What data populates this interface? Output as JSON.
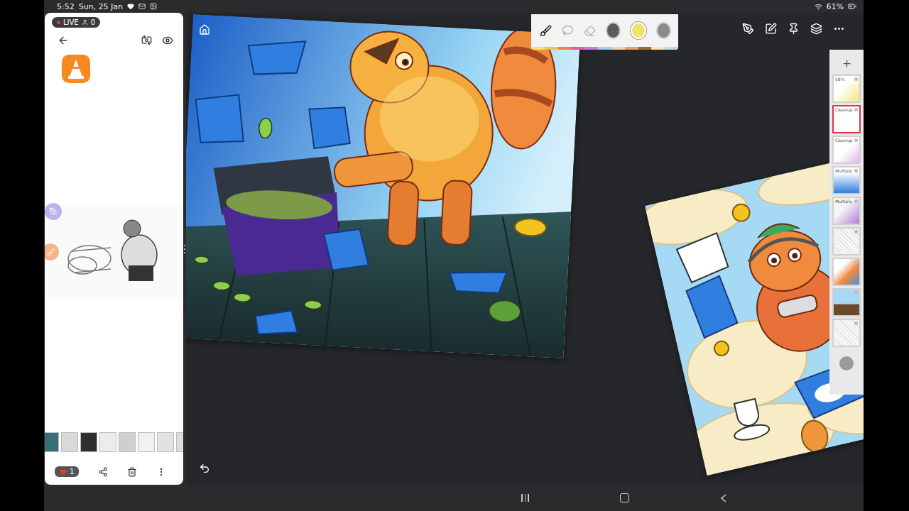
{
  "status_bar": {
    "time": "5:52",
    "date": "Sun, 25 Jan",
    "battery": "61%"
  },
  "gallery": {
    "live": {
      "label": "LIVE",
      "viewers": "0"
    },
    "comments": "1",
    "thumbnails": [
      {
        "color": "#3b6f76"
      },
      {
        "color": "#d9d9d9"
      },
      {
        "color": "#2f2f2f"
      },
      {
        "color": "#ececec"
      },
      {
        "color": "#cfcfcf"
      },
      {
        "color": "#f1f1f1"
      },
      {
        "color": "#e2e2e2"
      },
      {
        "color": "#dcdcdc"
      },
      {
        "color": "#1f2d66"
      }
    ]
  },
  "toolbar": {
    "tools": [
      {
        "kind": "brush",
        "selected": true
      },
      {
        "kind": "lasso",
        "selected": false
      },
      {
        "kind": "eraser",
        "selected": false
      }
    ],
    "swatches": [
      {
        "color": "#5c5c5c",
        "selected": false
      },
      {
        "color": "#f2e46b",
        "selected": true
      },
      {
        "color": "#8a8a8a",
        "selected": false
      }
    ],
    "palette": [
      "#f2e46b",
      "#f4c542",
      "#e9883a",
      "#e85aa0",
      "#c77be0",
      "#9ad0f0",
      "#f3d2a6",
      "#e9a35c",
      "#9b6a3c",
      "#f6e7a8",
      "#b7ddf5"
    ]
  },
  "layers": [
    {
      "label": "58%",
      "kind": "yellow",
      "selected": false,
      "visible": true
    },
    {
      "label": "Cleanup",
      "kind": "blank",
      "selected": true,
      "visible": true
    },
    {
      "label": "Cleanup",
      "kind": "pink",
      "selected": false,
      "visible": true
    },
    {
      "label": "Multiply",
      "kind": "sky",
      "selected": false,
      "visible": true
    },
    {
      "label": "Multiply",
      "kind": "purple",
      "selected": false,
      "visible": true
    },
    {
      "label": "",
      "kind": "sketch",
      "selected": false,
      "visible": true
    },
    {
      "label": "",
      "kind": "color",
      "selected": false,
      "visible": true
    },
    {
      "label": "",
      "kind": "ground",
      "selected": false,
      "visible": true
    },
    {
      "label": "",
      "kind": "sketch",
      "selected": false,
      "visible": true
    }
  ]
}
